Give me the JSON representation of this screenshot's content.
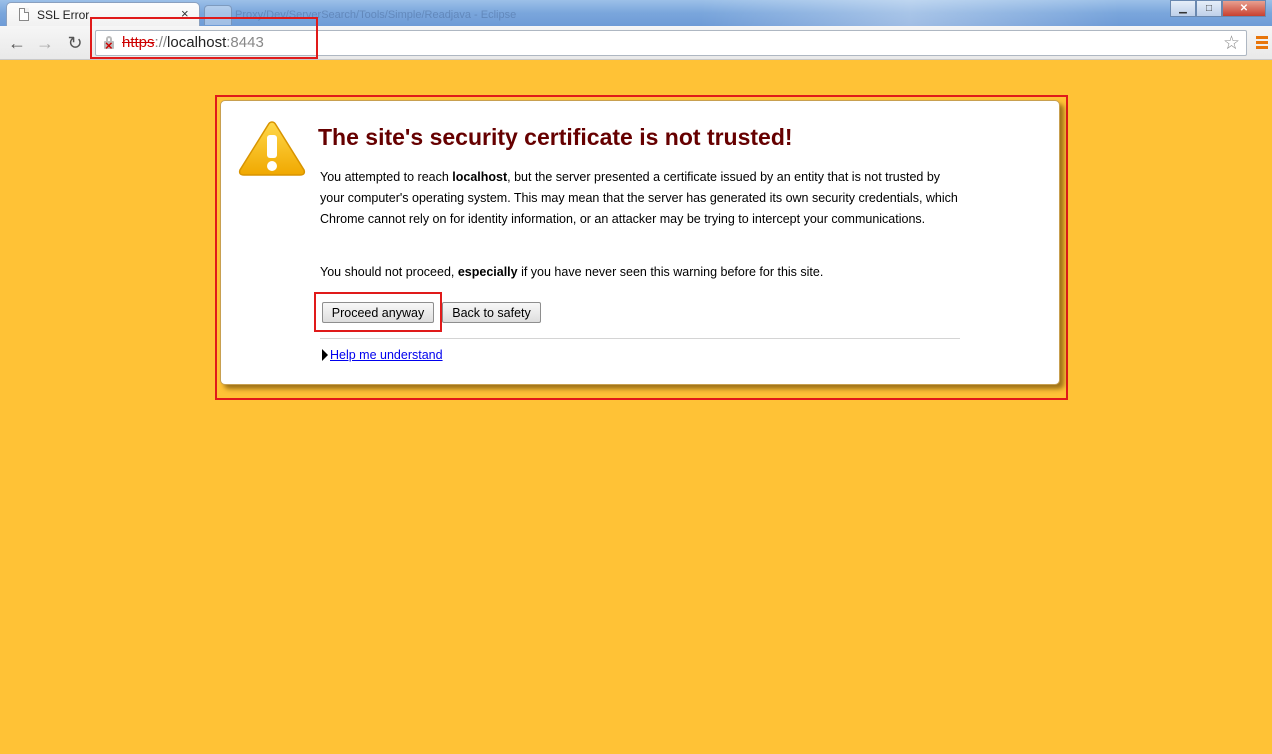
{
  "browser": {
    "tab_title": "SSL Error",
    "tab_close": "×",
    "background_tab_title": "Proxy/Dev/ServerSearch/Tools/Simple/Readjava - Eclipse",
    "window_controls": {
      "minimize": "▁",
      "maximize": "□",
      "close": "✕"
    },
    "nav": {
      "back": "←",
      "forward": "→",
      "reload": "↻"
    },
    "url": {
      "scheme": "https",
      "separator": "://",
      "host": "localhost",
      "port": ":8443"
    },
    "bookmark_star": "☆",
    "icons": {
      "security": "lock-broken-icon",
      "star": "star-icon",
      "menu": "menu-icon"
    }
  },
  "interstitial": {
    "headline": "The site's security certificate is not trusted!",
    "body": {
      "p1_a": "You attempted to reach ",
      "p1_host": "localhost",
      "p1_b": ", but the server presented a certificate issued by an entity that is not trusted by your computer's operating system. This may mean that the server has generated its own security credentials, which Chrome cannot rely on for identity information, or an attacker may be trying to intercept your communications."
    },
    "advice": {
      "a": "You should not proceed, ",
      "strong": "especially",
      "b": " if you have never seen this warning before for this site."
    },
    "buttons": {
      "proceed": "Proceed anyway",
      "back": "Back to safety"
    },
    "help_link": "Help me understand"
  },
  "colors": {
    "page_background": "#ffc236",
    "headline": "#660000",
    "annotation_box": "#e01a1a",
    "link": "#0000ee"
  }
}
